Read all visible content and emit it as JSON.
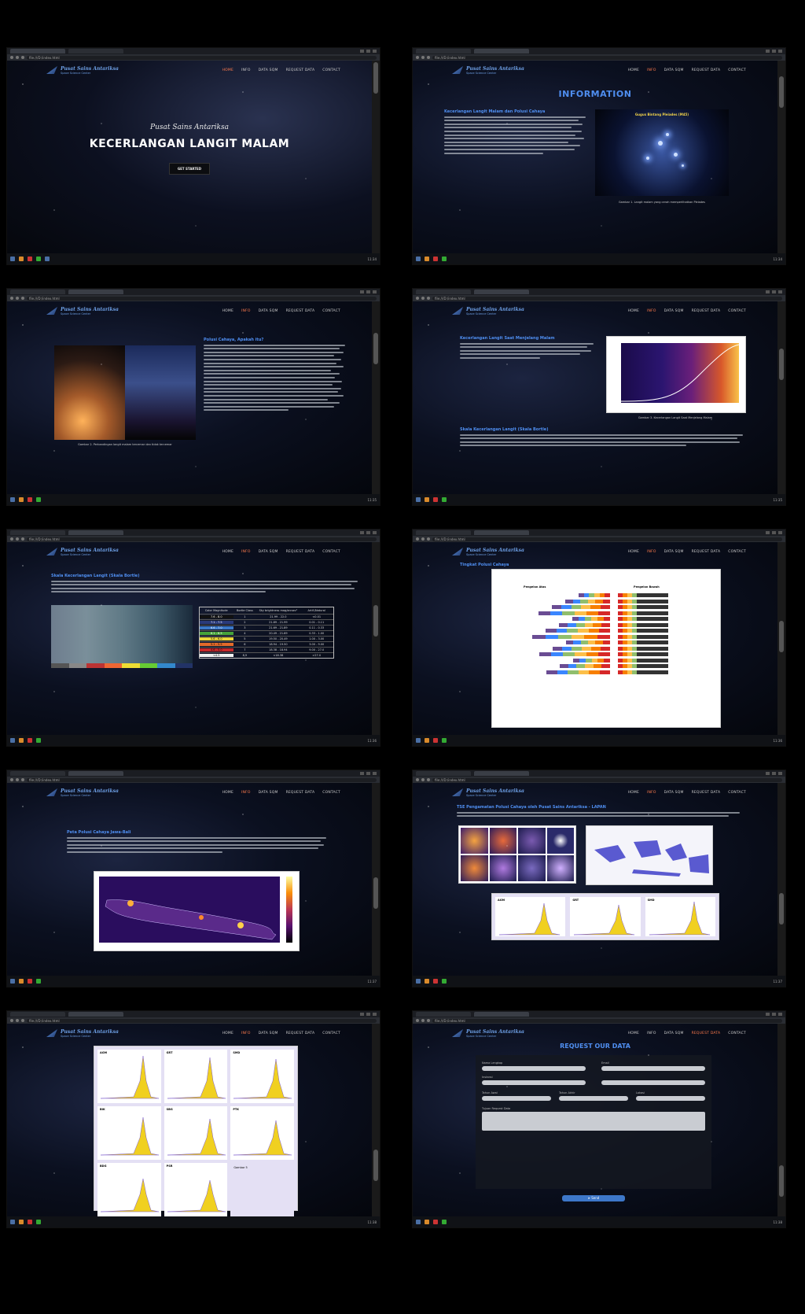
{
  "site": {
    "brand_name": "Pusat Sains Antariksa",
    "brand_sub": "Space Science Center",
    "nav": [
      "HOME",
      "INFO",
      "DATA SQM",
      "REQUEST DATA",
      "CONTACT"
    ]
  },
  "hero": {
    "kicker": "Pusat Sains Antariksa",
    "title": "KECERLANGAN LANGIT MALAM",
    "cta": "GET STARTED"
  },
  "info": {
    "heading": "INFORMATION",
    "section1_title": "Kecerlangan Langit Malam dan Polusi Cahaya",
    "image1_title": "Gugus Bintang Pleiades (M45)",
    "caption1": "Gambar 1. Langit malam yang cerah memperlihatkan Pleiades",
    "section2_title": "Polusi Cahaya, Apakah itu?",
    "caption2": "Gambar 2. Perbandingan langit malam tercemar dan tidak tercemar",
    "section3_title": "Kecerlangan Langit Saat Menjelang Malam",
    "caption3": "Gambar 3. Kecerlangan Langit Saat Menjelang Malam",
    "section4_title": "Skala Kecerlangan Langit (Skala Bortle)",
    "section5_title": "Tingkat Polusi Cahaya",
    "section6_title": "Peta Polusi Cahaya Jawa-Bali",
    "section7_title": "TSE Pengamatan Polusi Cahaya oleh Pusat Sains Antariksa - LAPAN",
    "table": {
      "headers": [
        "Color Magnitude",
        "Bortle Class",
        "Sky brightness mag/arcsec²",
        "Artif./Natural"
      ],
      "rows": [
        [
          "7.6 - 8.0",
          "1",
          "21.99 - 22.0",
          "<0.01"
        ],
        [
          "7.1 - 7.5",
          "2",
          "21.89 - 21.99",
          "0.01 - 0.11"
        ],
        [
          "6.6 - 7.0",
          "3",
          "21.69 - 21.89",
          "0.11 - 0.33"
        ],
        [
          "6.1 - 6.5",
          "4",
          "20.49 - 21.69",
          "0.33 - 1.00"
        ],
        [
          "5.6 - 6.0",
          "5",
          "19.50 - 20.49",
          "1.00 - 3.00"
        ],
        [
          "5.1 - 5.5",
          "6",
          "18.94 - 19.50",
          "3.00 - 9.00"
        ],
        [
          "4.6 - 5.0",
          "7",
          "18.38 - 18.94",
          "9.00 - 27.0"
        ],
        [
          "<4.5",
          "8,9",
          "<18.38",
          ">27.0"
        ]
      ]
    },
    "bar_legend": [
      "Pengelan Atas",
      "Pengelan Bawah"
    ],
    "station_labels": [
      "AGM",
      "GRT",
      "SMD",
      "BIK",
      "SBG",
      "PTK",
      "BDG",
      "PSR"
    ]
  },
  "request": {
    "heading": "REQUEST OUR DATA",
    "fields": [
      "Nama Lengkap",
      "Email",
      "Instansi",
      "Tahun Awal",
      "Tahun Akhir",
      "Lokasi"
    ],
    "message_label": "Tujuan Request Data",
    "send": "➤ Send"
  },
  "browser": {
    "url": "file:///D:/index.html"
  }
}
